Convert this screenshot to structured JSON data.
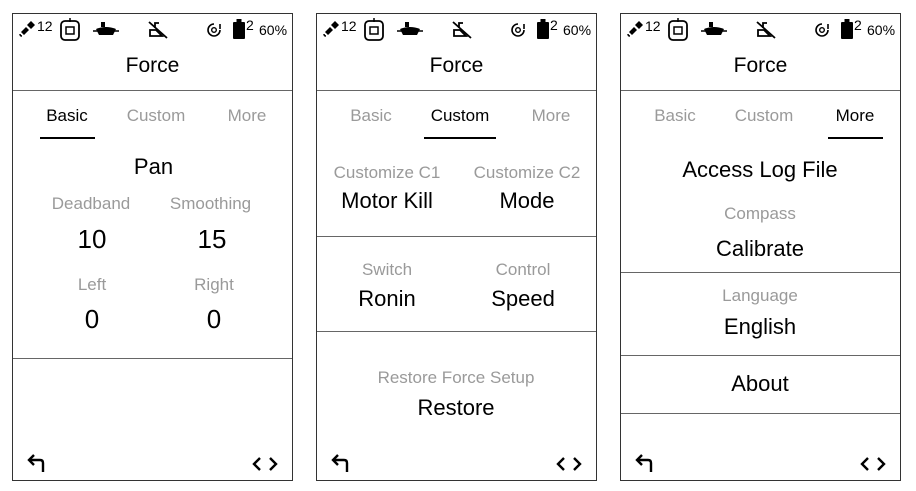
{
  "status": {
    "satellite_count": "12",
    "battery_index": "2",
    "battery_percent": "60%"
  },
  "header": {
    "title": "Force"
  },
  "tabs": [
    "Basic",
    "Custom",
    "More"
  ],
  "basic": {
    "axis": "Pan",
    "deadband_label": "Deadband",
    "deadband_value": "10",
    "smoothing_label": "Smoothing",
    "smoothing_value": "15",
    "left_label": "Left",
    "left_value": "0",
    "right_label": "Right",
    "right_value": "0"
  },
  "custom": {
    "c1_label": "Customize C1",
    "c1_value": "Motor Kill",
    "c2_label": "Customize C2",
    "c2_value": "Mode",
    "switch_label": "Switch",
    "switch_value": "Ronin",
    "control_label": "Control",
    "control_value": "Speed",
    "restore_label": "Restore Force Setup",
    "restore_button": "Restore"
  },
  "more": {
    "access_log": "Access Log File",
    "compass_label": "Compass",
    "compass_button": "Calibrate",
    "language_label": "Language",
    "language_value": "English",
    "about": "About"
  },
  "icons": [
    "satellite-icon",
    "remote-controller-icon",
    "gimbal-icon",
    "mute-icon",
    "dial-icon",
    "battery-icon",
    "back-arrow-icon",
    "left-right-arrows-icon"
  ]
}
